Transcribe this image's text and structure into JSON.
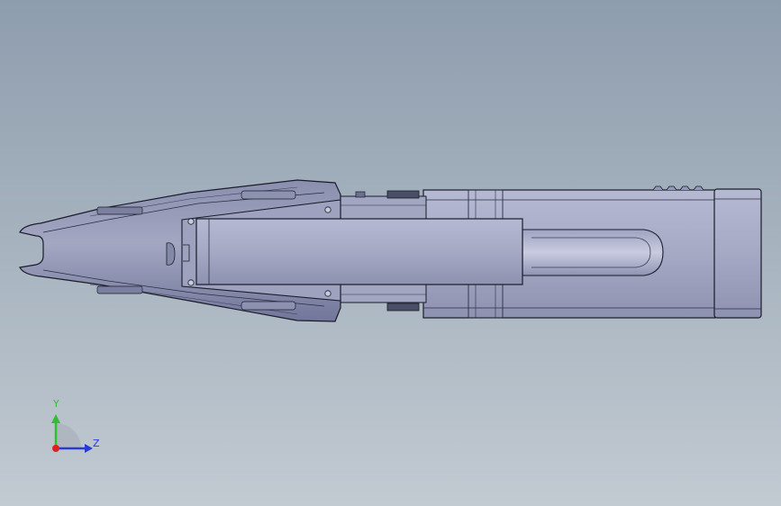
{
  "viewport": {
    "background_top": "#8e9dae",
    "background_bottom": "#c2cad2"
  },
  "model": {
    "part": "clamp-meter-assembly",
    "view": "top",
    "face_color": "#a9adc8",
    "edge_color": "#1a1c2a",
    "shadow_color": "#6e7392"
  },
  "triad": {
    "y_label": "Y",
    "z_label": "Z",
    "y_color": "#2fbf2f",
    "z_color": "#2a3ad8",
    "x_color": "#e02020"
  }
}
